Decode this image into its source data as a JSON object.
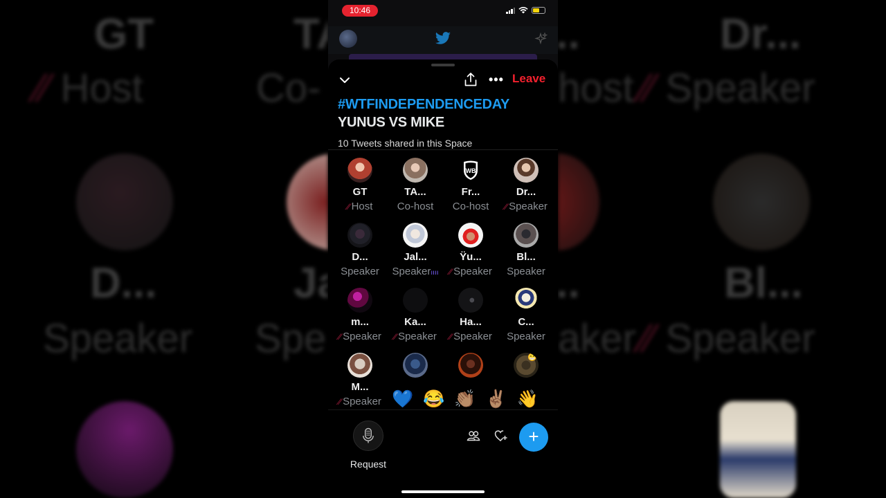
{
  "status_bar": {
    "time": "10:46"
  },
  "space": {
    "hashtag": "#WTFINDEPENDENCEDAY",
    "title": "YUNUS VS MIKE",
    "tweets_shared": "10 Tweets shared in this Space",
    "leave_label": "Leave"
  },
  "participants": [
    {
      "name": "GT",
      "role": "Host",
      "mark": "slash",
      "avatar": "red-hair"
    },
    {
      "name": "TA...",
      "role": "Co-host",
      "mark": "none",
      "avatar": "blonde"
    },
    {
      "name": "Fr...",
      "role": "Co-host",
      "mark": "none",
      "avatar": "wb-logo"
    },
    {
      "name": "Dr...",
      "role": "Speaker",
      "mark": "slash",
      "avatar": "person-light"
    },
    {
      "name": "D...",
      "role": "Speaker",
      "mark": "none",
      "avatar": "dark-figure"
    },
    {
      "name": "Jal...",
      "role": "Speaker",
      "mark": "wave",
      "avatar": "cartoon"
    },
    {
      "name": "Ÿu...",
      "role": "Speaker",
      "mark": "slash",
      "avatar": "red-cap"
    },
    {
      "name": "Bl...",
      "role": "Speaker",
      "mark": "none",
      "avatar": "standing"
    },
    {
      "name": "m...",
      "role": "Speaker",
      "mark": "slash",
      "avatar": "purple-light"
    },
    {
      "name": "Ka...",
      "role": "Speaker",
      "mark": "slash",
      "avatar": "black"
    },
    {
      "name": "Ha...",
      "role": "Speaker",
      "mark": "slash",
      "avatar": "dark-scene"
    },
    {
      "name": "C...",
      "role": "Speaker",
      "mark": "none",
      "avatar": "cowboy"
    },
    {
      "name": "M...",
      "role": "Speaker",
      "mark": "slash",
      "avatar": "bald"
    },
    {
      "name": "",
      "role": "",
      "mark": "none",
      "avatar": "blue-face"
    },
    {
      "name": "",
      "role": "",
      "mark": "none",
      "avatar": "woman"
    },
    {
      "name": "",
      "role": "",
      "mark": "none",
      "avatar": "emoji-face"
    }
  ],
  "reactions": [
    "💙",
    "😂",
    "👏🏽",
    "✌🏽",
    "👋"
  ],
  "bottom_bar": {
    "request_label": "Request"
  },
  "background": {
    "left_names": [
      "GT",
      "TA"
    ],
    "left_roles": [
      "Host",
      "Co-"
    ],
    "left_names_row2": [
      "D...",
      "Ja"
    ],
    "left_roles_row2": [
      "Speaker",
      "Spe"
    ],
    "right_names": [
      "Dr...",
      "..."
    ],
    "right_roles": [
      "Speaker",
      "host"
    ],
    "right_names_row2": [
      "Bl...",
      "..."
    ],
    "right_roles_row2": [
      "Speaker",
      "aker"
    ]
  }
}
